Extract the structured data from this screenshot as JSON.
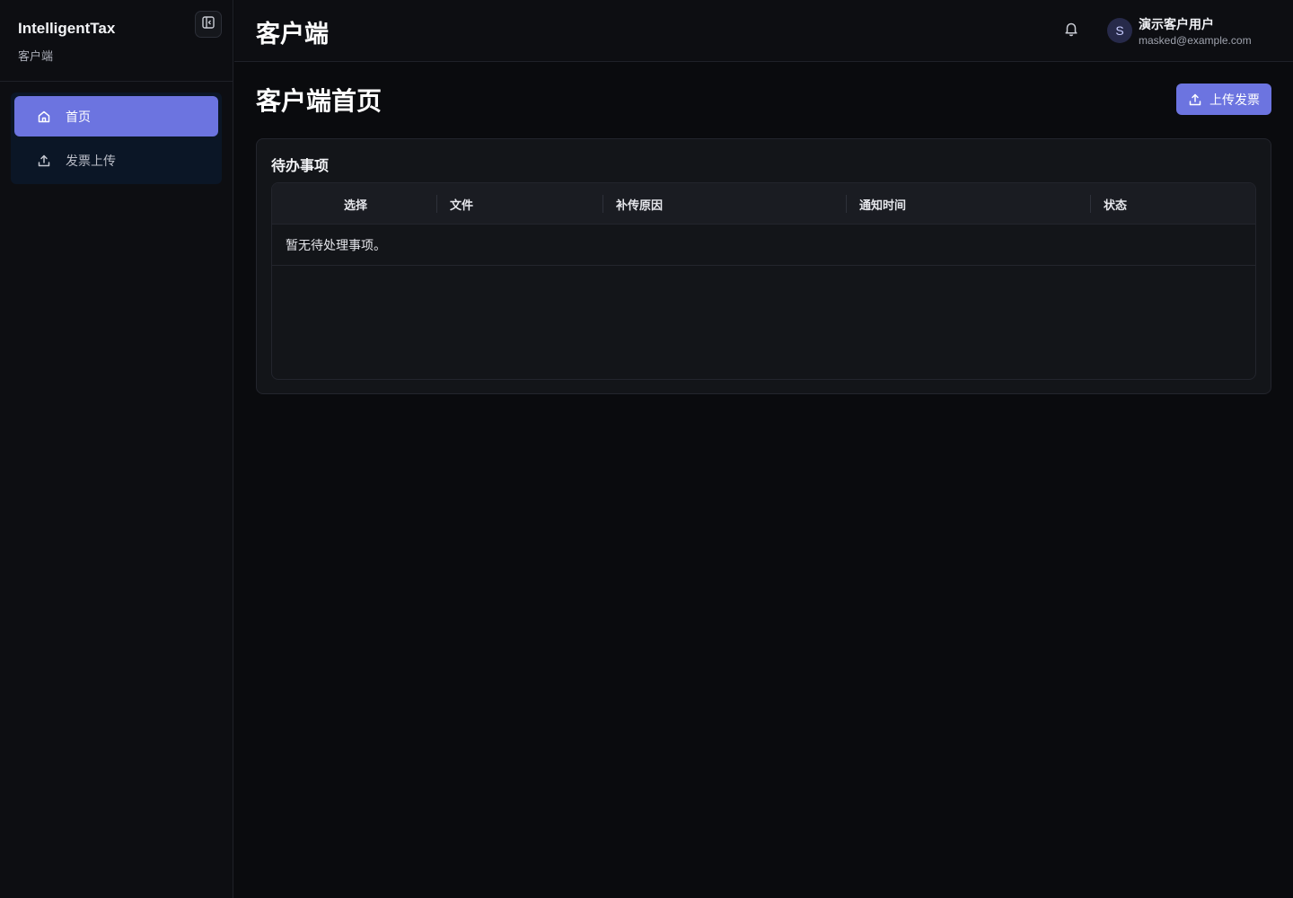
{
  "sidebar": {
    "brand_title": "IntelligentTax",
    "brand_subtitle": "客户端",
    "collapse_icon": "sidebar-collapse-icon",
    "items": [
      {
        "label": "首页",
        "icon": "home-icon",
        "active": true
      },
      {
        "label": "发票上传",
        "icon": "upload-icon",
        "active": false
      }
    ]
  },
  "header": {
    "title": "客户端",
    "user": {
      "avatar_letter": "S",
      "name": "演示客户用户",
      "email": "masked@example.com"
    }
  },
  "main": {
    "page_title": "客户端首页",
    "upload_button_label": "上传发票",
    "todo": {
      "title": "待办事项",
      "columns": [
        "选择",
        "文件",
        "补传原因",
        "通知时间",
        "状态"
      ],
      "empty_message": "暂无待处理事项。"
    }
  },
  "colors": {
    "accent": "#6c74e0",
    "background": "#0a0b0e",
    "panel": "#131519"
  }
}
